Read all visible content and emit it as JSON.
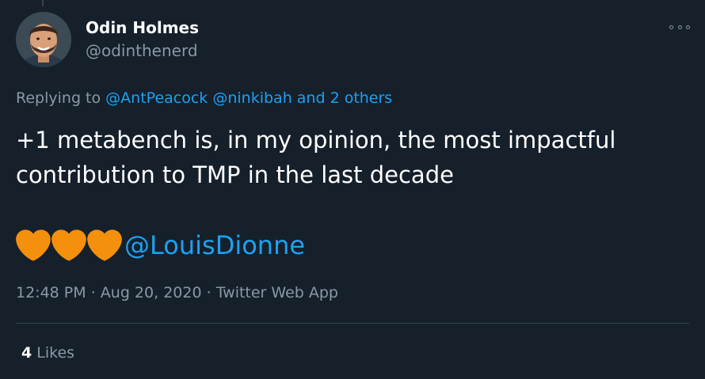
{
  "author": {
    "name": "Odin Holmes",
    "handle": "@odinthenerd"
  },
  "reply": {
    "prefix": "Replying to",
    "mentions": [
      "@AntPeacock",
      "@ninkibah",
      "and 2 others"
    ]
  },
  "tweet": {
    "lines": [
      "+1 metabench is, in my opinion, the most impactful",
      "contribution to TMP in the last decade"
    ],
    "hearts_mention": "@LouisDionne",
    "heart_icons": [
      "orange-heart-icon",
      "orange-heart-icon",
      "orange-heart-icon"
    ]
  },
  "meta": {
    "time": "12:48 PM",
    "separator": "·",
    "date": "Aug 20, 2020",
    "source": "Twitter Web App"
  },
  "stats": {
    "likes_count": "4",
    "likes_label": "Likes"
  },
  "icons": {
    "more": "more-options-icon",
    "heart": "orange-heart-icon"
  },
  "colors": {
    "background": "#15202b",
    "text_primary": "#ffffff",
    "text_secondary": "#8899a6",
    "link": "#1da1f2",
    "heart": "#f4900c",
    "divider": "#38444d"
  }
}
